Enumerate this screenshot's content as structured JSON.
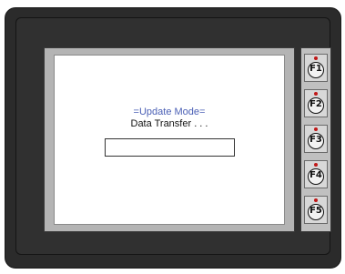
{
  "screen": {
    "mode_title": "=Update Mode=",
    "status_text": "Data Transfer . . .",
    "progress": 0
  },
  "function_keys": [
    {
      "label": "F1"
    },
    {
      "label": "F2"
    },
    {
      "label": "F3"
    },
    {
      "label": "F4"
    },
    {
      "label": "F5"
    }
  ],
  "colors": {
    "mode_title": "#4a5fb5",
    "led": "#c01818",
    "housing": "#2b2b2b",
    "bezel": "#b4b4b4"
  }
}
